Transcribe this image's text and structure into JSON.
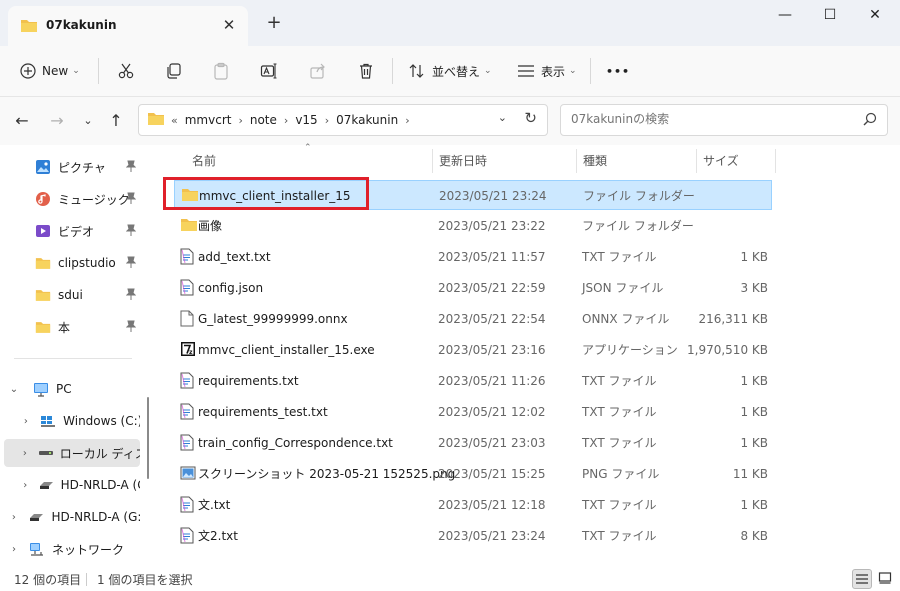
{
  "window": {
    "tab_title": "07kakunin",
    "tab_close": "✕",
    "new_tab": "+",
    "minimize": "—",
    "maximize": "☐",
    "close": "✕"
  },
  "toolbar": {
    "new_label": "New",
    "sort_label": "並べ替え",
    "view_label": "表示",
    "more_label": "•••"
  },
  "address": {
    "overflow": "«",
    "crumbs": [
      "mmvcrt",
      "note",
      "v15",
      "07kakunin"
    ],
    "search_placeholder": "07kakuninの検索"
  },
  "sidebar": {
    "quick": [
      {
        "label": "ピクチャ",
        "icon": "pictures-icon"
      },
      {
        "label": "ミュージック",
        "icon": "music-icon"
      },
      {
        "label": "ビデオ",
        "icon": "videos-icon"
      },
      {
        "label": "clipstudio",
        "icon": "folder-icon"
      },
      {
        "label": "sdui",
        "icon": "folder-icon"
      },
      {
        "label": "本",
        "icon": "folder-icon"
      }
    ],
    "pc_label": "PC",
    "drives": [
      {
        "label": "Windows (C:)"
      },
      {
        "label": "ローカル ディスク"
      },
      {
        "label": "HD-NRLD-A (G:"
      }
    ],
    "hd_label": "HD-NRLD-A (G:",
    "network_label": "ネットワーク"
  },
  "columns": {
    "name": "名前",
    "date": "更新日時",
    "type": "種類",
    "size": "サイズ"
  },
  "files": [
    {
      "name": "mmvc_client_installer_15",
      "date": "2023/05/21 23:24",
      "type": "ファイル フォルダー",
      "size": "",
      "icon": "folder-icon"
    },
    {
      "name": "画像",
      "date": "2023/05/21 23:22",
      "type": "ファイル フォルダー",
      "size": "",
      "icon": "folder-icon"
    },
    {
      "name": "add_text.txt",
      "date": "2023/05/21 11:57",
      "type": "TXT ファイル",
      "size": "1 KB",
      "icon": "text-file-icon"
    },
    {
      "name": "config.json",
      "date": "2023/05/21 22:59",
      "type": "JSON ファイル",
      "size": "3 KB",
      "icon": "text-file-icon"
    },
    {
      "name": "G_latest_99999999.onnx",
      "date": "2023/05/21 22:54",
      "type": "ONNX ファイル",
      "size": "216,311 KB",
      "icon": "blank-file-icon"
    },
    {
      "name": "mmvc_client_installer_15.exe",
      "date": "2023/05/21 23:16",
      "type": "アプリケーション",
      "size": "1,970,510 KB",
      "icon": "sevenzip-icon"
    },
    {
      "name": "requirements.txt",
      "date": "2023/05/21 11:26",
      "type": "TXT ファイル",
      "size": "1 KB",
      "icon": "text-file-icon"
    },
    {
      "name": "requirements_test.txt",
      "date": "2023/05/21 12:02",
      "type": "TXT ファイル",
      "size": "1 KB",
      "icon": "text-file-icon"
    },
    {
      "name": "train_config_Correspondence.txt",
      "date": "2023/05/21 23:03",
      "type": "TXT ファイル",
      "size": "1 KB",
      "icon": "text-file-icon"
    },
    {
      "name": "スクリーンショット 2023-05-21 152525.png",
      "date": "2023/05/21 15:25",
      "type": "PNG ファイル",
      "size": "11 KB",
      "icon": "image-file-icon"
    },
    {
      "name": "文.txt",
      "date": "2023/05/21 12:18",
      "type": "TXT ファイル",
      "size": "1 KB",
      "icon": "text-file-icon"
    },
    {
      "name": "文2.txt",
      "date": "2023/05/21 23:24",
      "type": "TXT ファイル",
      "size": "8 KB",
      "icon": "text-file-icon"
    }
  ],
  "status": {
    "count": "12 個の項目",
    "selected": "1 個の項目を選択"
  },
  "colors": {
    "selection": "#cce8ff",
    "highlight_box": "#e0202a",
    "folder": "#f2c14e"
  }
}
